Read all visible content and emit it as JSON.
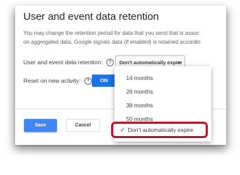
{
  "dialog": {
    "title": "User and event data retention",
    "description_line1": "You may change the retention period for data that you send that is assoc",
    "description_line2": "on aggregated data. Google signals data (if enabled) is retained accordin"
  },
  "retention": {
    "label": "User and event data retention:",
    "help_icon": "?",
    "selected_value": "Don't automatically expire",
    "options": [
      "14 months",
      "26 months",
      "38 months",
      "50 months",
      "Don't automatically expire"
    ],
    "check_mark": "✓"
  },
  "reset": {
    "label": "Reset on new activity:",
    "help_icon": "?",
    "toggle_label": "ON"
  },
  "actions": {
    "save_label": "Save",
    "cancel_label": "Cancel"
  },
  "colors": {
    "accent": "#1a73e8",
    "save_button": "#4285f4",
    "highlight_border": "#b0182a"
  }
}
